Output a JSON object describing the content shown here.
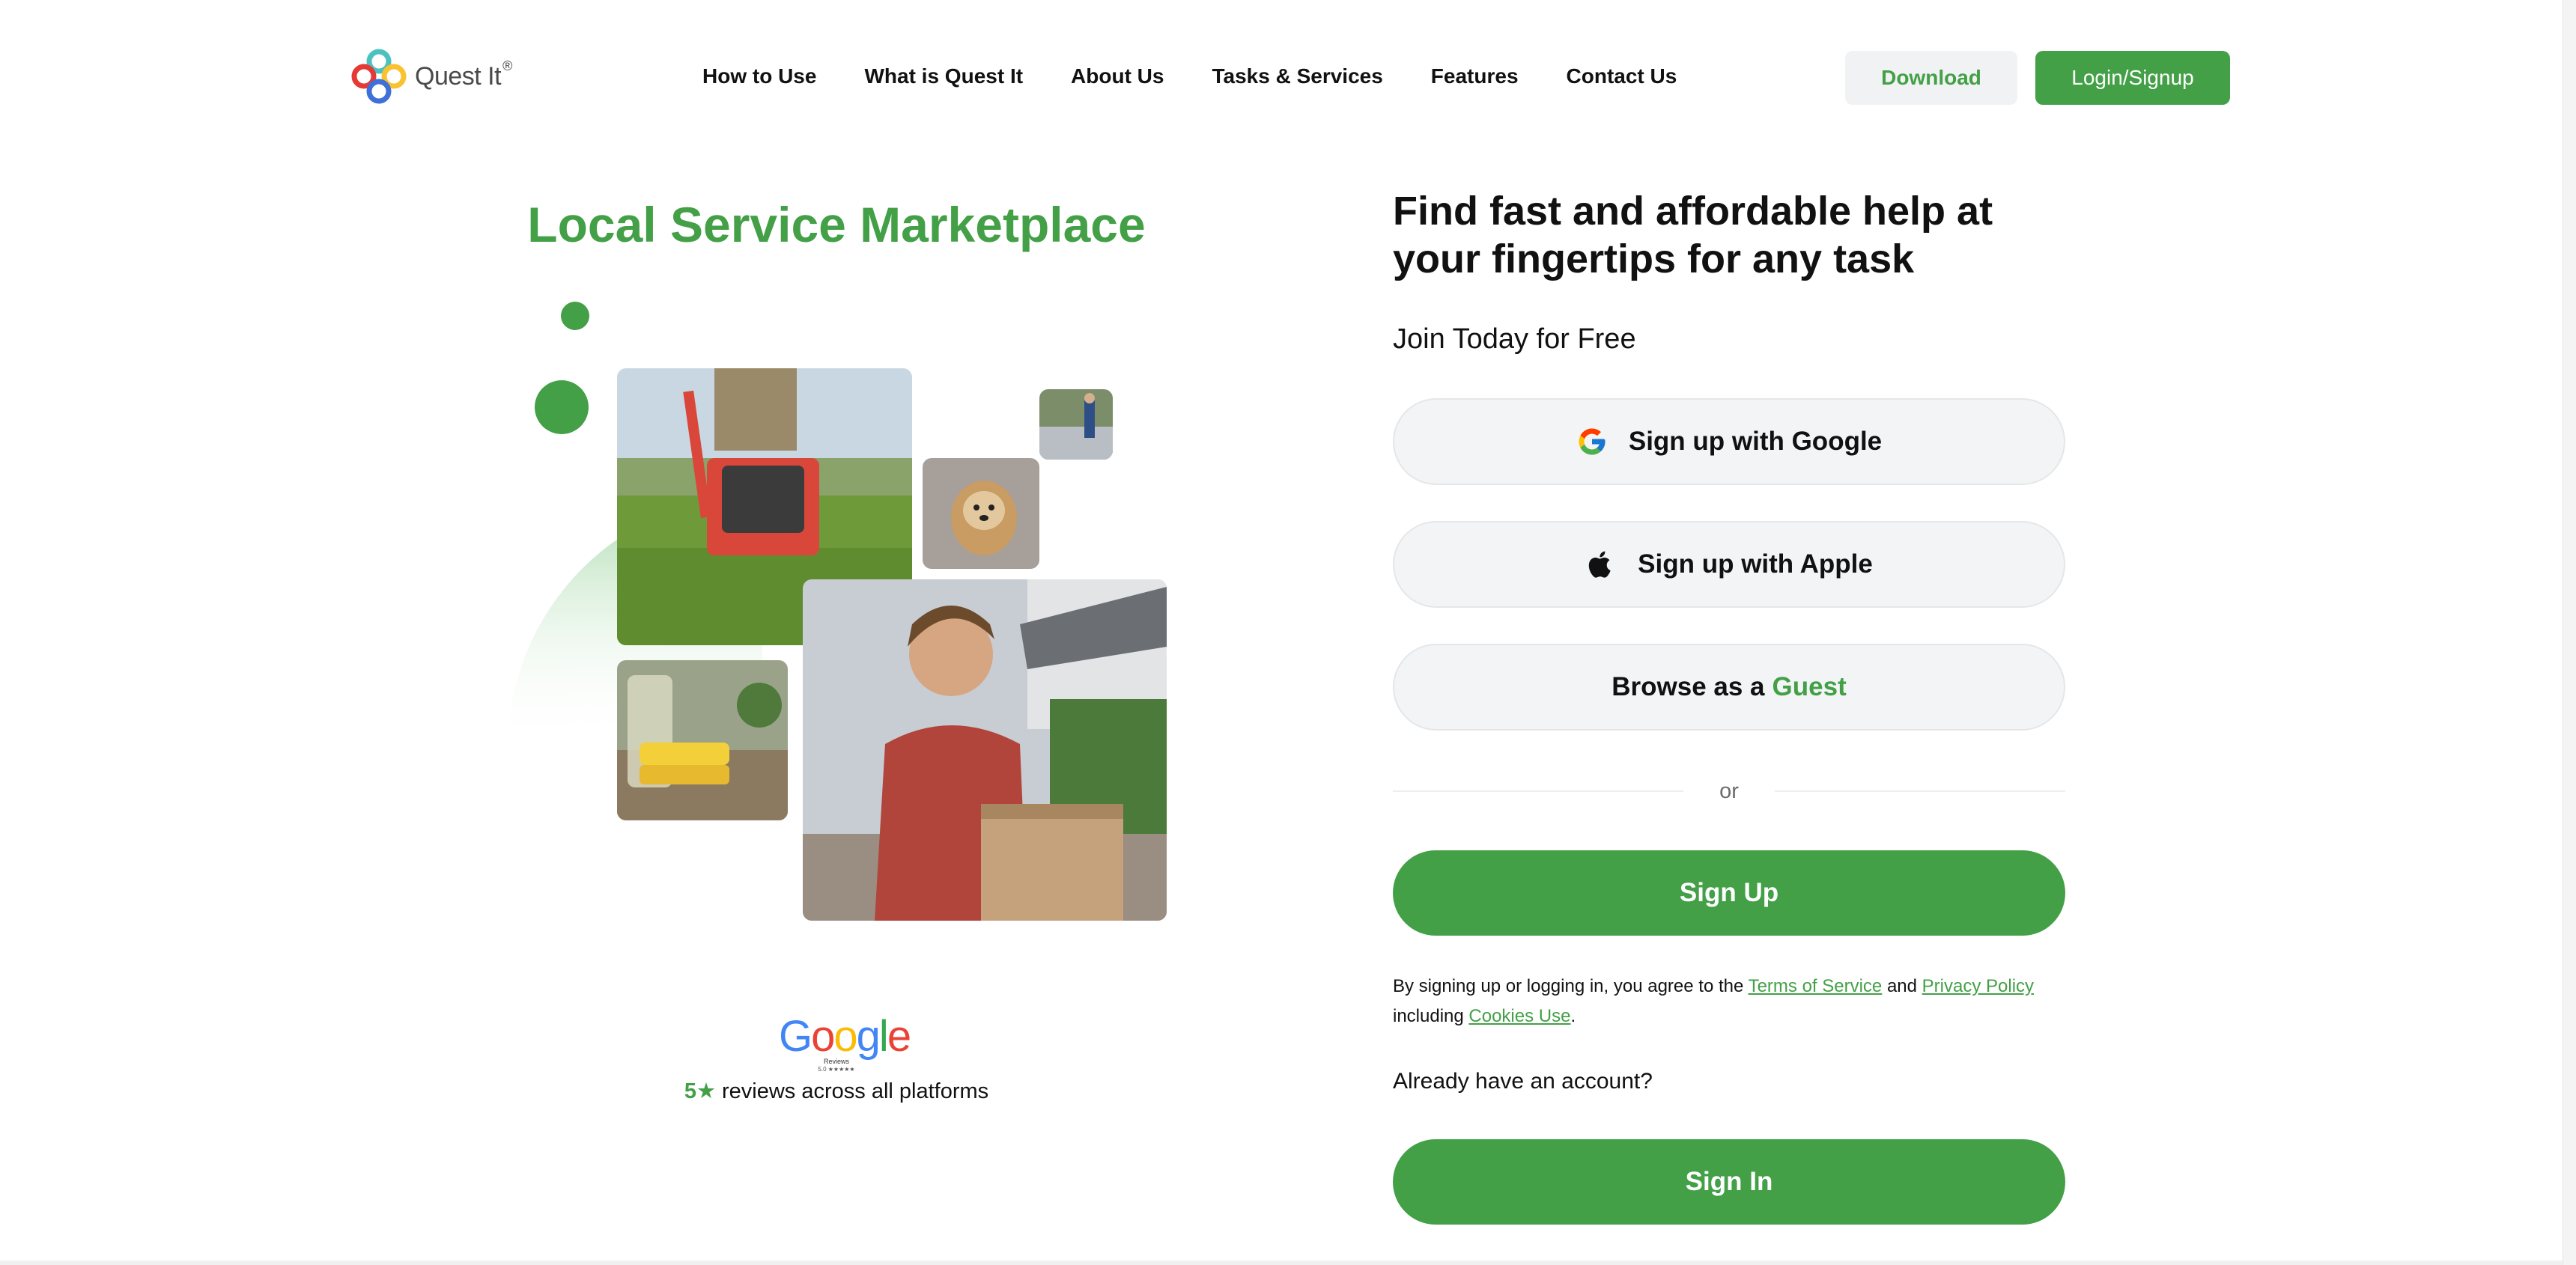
{
  "header": {
    "brand": "Quest It",
    "brand_mark": "®",
    "nav": [
      "How to Use",
      "What is Quest It",
      "About Us",
      "Tasks & Services",
      "Features",
      "Contact Us"
    ],
    "download_label": "Download",
    "login_label": "Login/Signup"
  },
  "hero": {
    "title": "Local Service Marketplace",
    "photos": [
      "lawn-mowing-photo",
      "pressure-washing-photo",
      "small-dog-photo",
      "cleaning-supplies-photo",
      "delivery-man-photo"
    ],
    "google_reviews": {
      "logo_text": "Google",
      "sub_label": "Reviews",
      "rating_line": "5.0 ★★★★★"
    },
    "review_five": "5★",
    "review_text": " reviews across all platforms"
  },
  "signup": {
    "tagline": "Find fast and affordable help at your fingertips for any task",
    "join_text": "Join Today for Free",
    "google_label": "Sign up with Google",
    "apple_label": "Sign up with Apple",
    "browse_prefix": "Browse as a",
    "browse_guest": "Guest",
    "or_text": "or",
    "signup_label": "Sign Up",
    "legal": {
      "prefix": "By signing up or logging in, you agree to the ",
      "terms": "Terms of Service",
      "and": " and ",
      "privacy": "Privacy Policy",
      "including": "including ",
      "cookies": "Cookies Use",
      "end": "."
    },
    "already_text": "Already have an account?",
    "signin_label": "Sign In"
  },
  "colors": {
    "accent": "#43a047",
    "button_light": "#f3f4f5",
    "text": "#111111"
  }
}
